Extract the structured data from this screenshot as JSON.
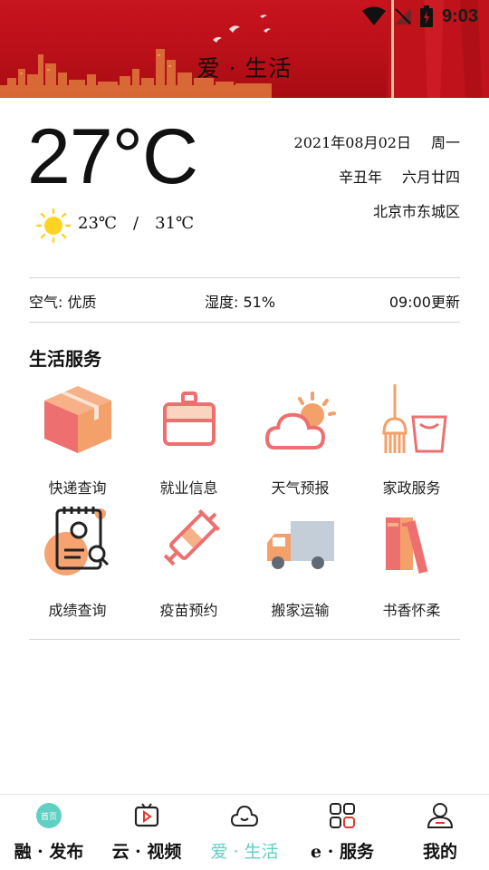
{
  "status_bar": {
    "time": "9:03"
  },
  "header": {
    "title": "爱 · 生活"
  },
  "weather": {
    "temperature": "27°C",
    "low": "23℃",
    "separator": "/",
    "high": "31℃",
    "date": "2021年08月02日",
    "weekday": "周一",
    "lunar_year": "辛丑年",
    "lunar_date": "六月廿四",
    "location": "北京市东城区",
    "air_quality": "空气: 优质",
    "humidity": "湿度: 51%",
    "updated": "09:00更新"
  },
  "services": {
    "title": "生活服务",
    "items": [
      {
        "label": "快递查询",
        "icon": "package-icon"
      },
      {
        "label": "就业信息",
        "icon": "briefcase-icon"
      },
      {
        "label": "天气预报",
        "icon": "weather-icon"
      },
      {
        "label": "家政服务",
        "icon": "broom-bucket-icon"
      },
      {
        "label": "成绩查询",
        "icon": "certificate-icon"
      },
      {
        "label": "疫苗预约",
        "icon": "syringe-icon"
      },
      {
        "label": "搬家运输",
        "icon": "truck-icon"
      },
      {
        "label": "书香怀柔",
        "icon": "books-icon"
      }
    ]
  },
  "tabbar": {
    "items": [
      {
        "label": "融 · 发布",
        "icon": "home-badge-icon",
        "badge": "首页"
      },
      {
        "label": "云 · 视频",
        "icon": "tv-play-icon"
      },
      {
        "label": "爱 · 生活",
        "icon": "cloud-smile-icon",
        "active": true
      },
      {
        "label": "e · 服务",
        "icon": "grid-apps-icon"
      },
      {
        "label": "我的",
        "icon": "user-icon"
      }
    ]
  },
  "colors": {
    "banner_red": "#c8141e",
    "accent_orange": "#f4a06a",
    "accent_pink": "#f07575",
    "active_tab": "#5fd0c2"
  }
}
